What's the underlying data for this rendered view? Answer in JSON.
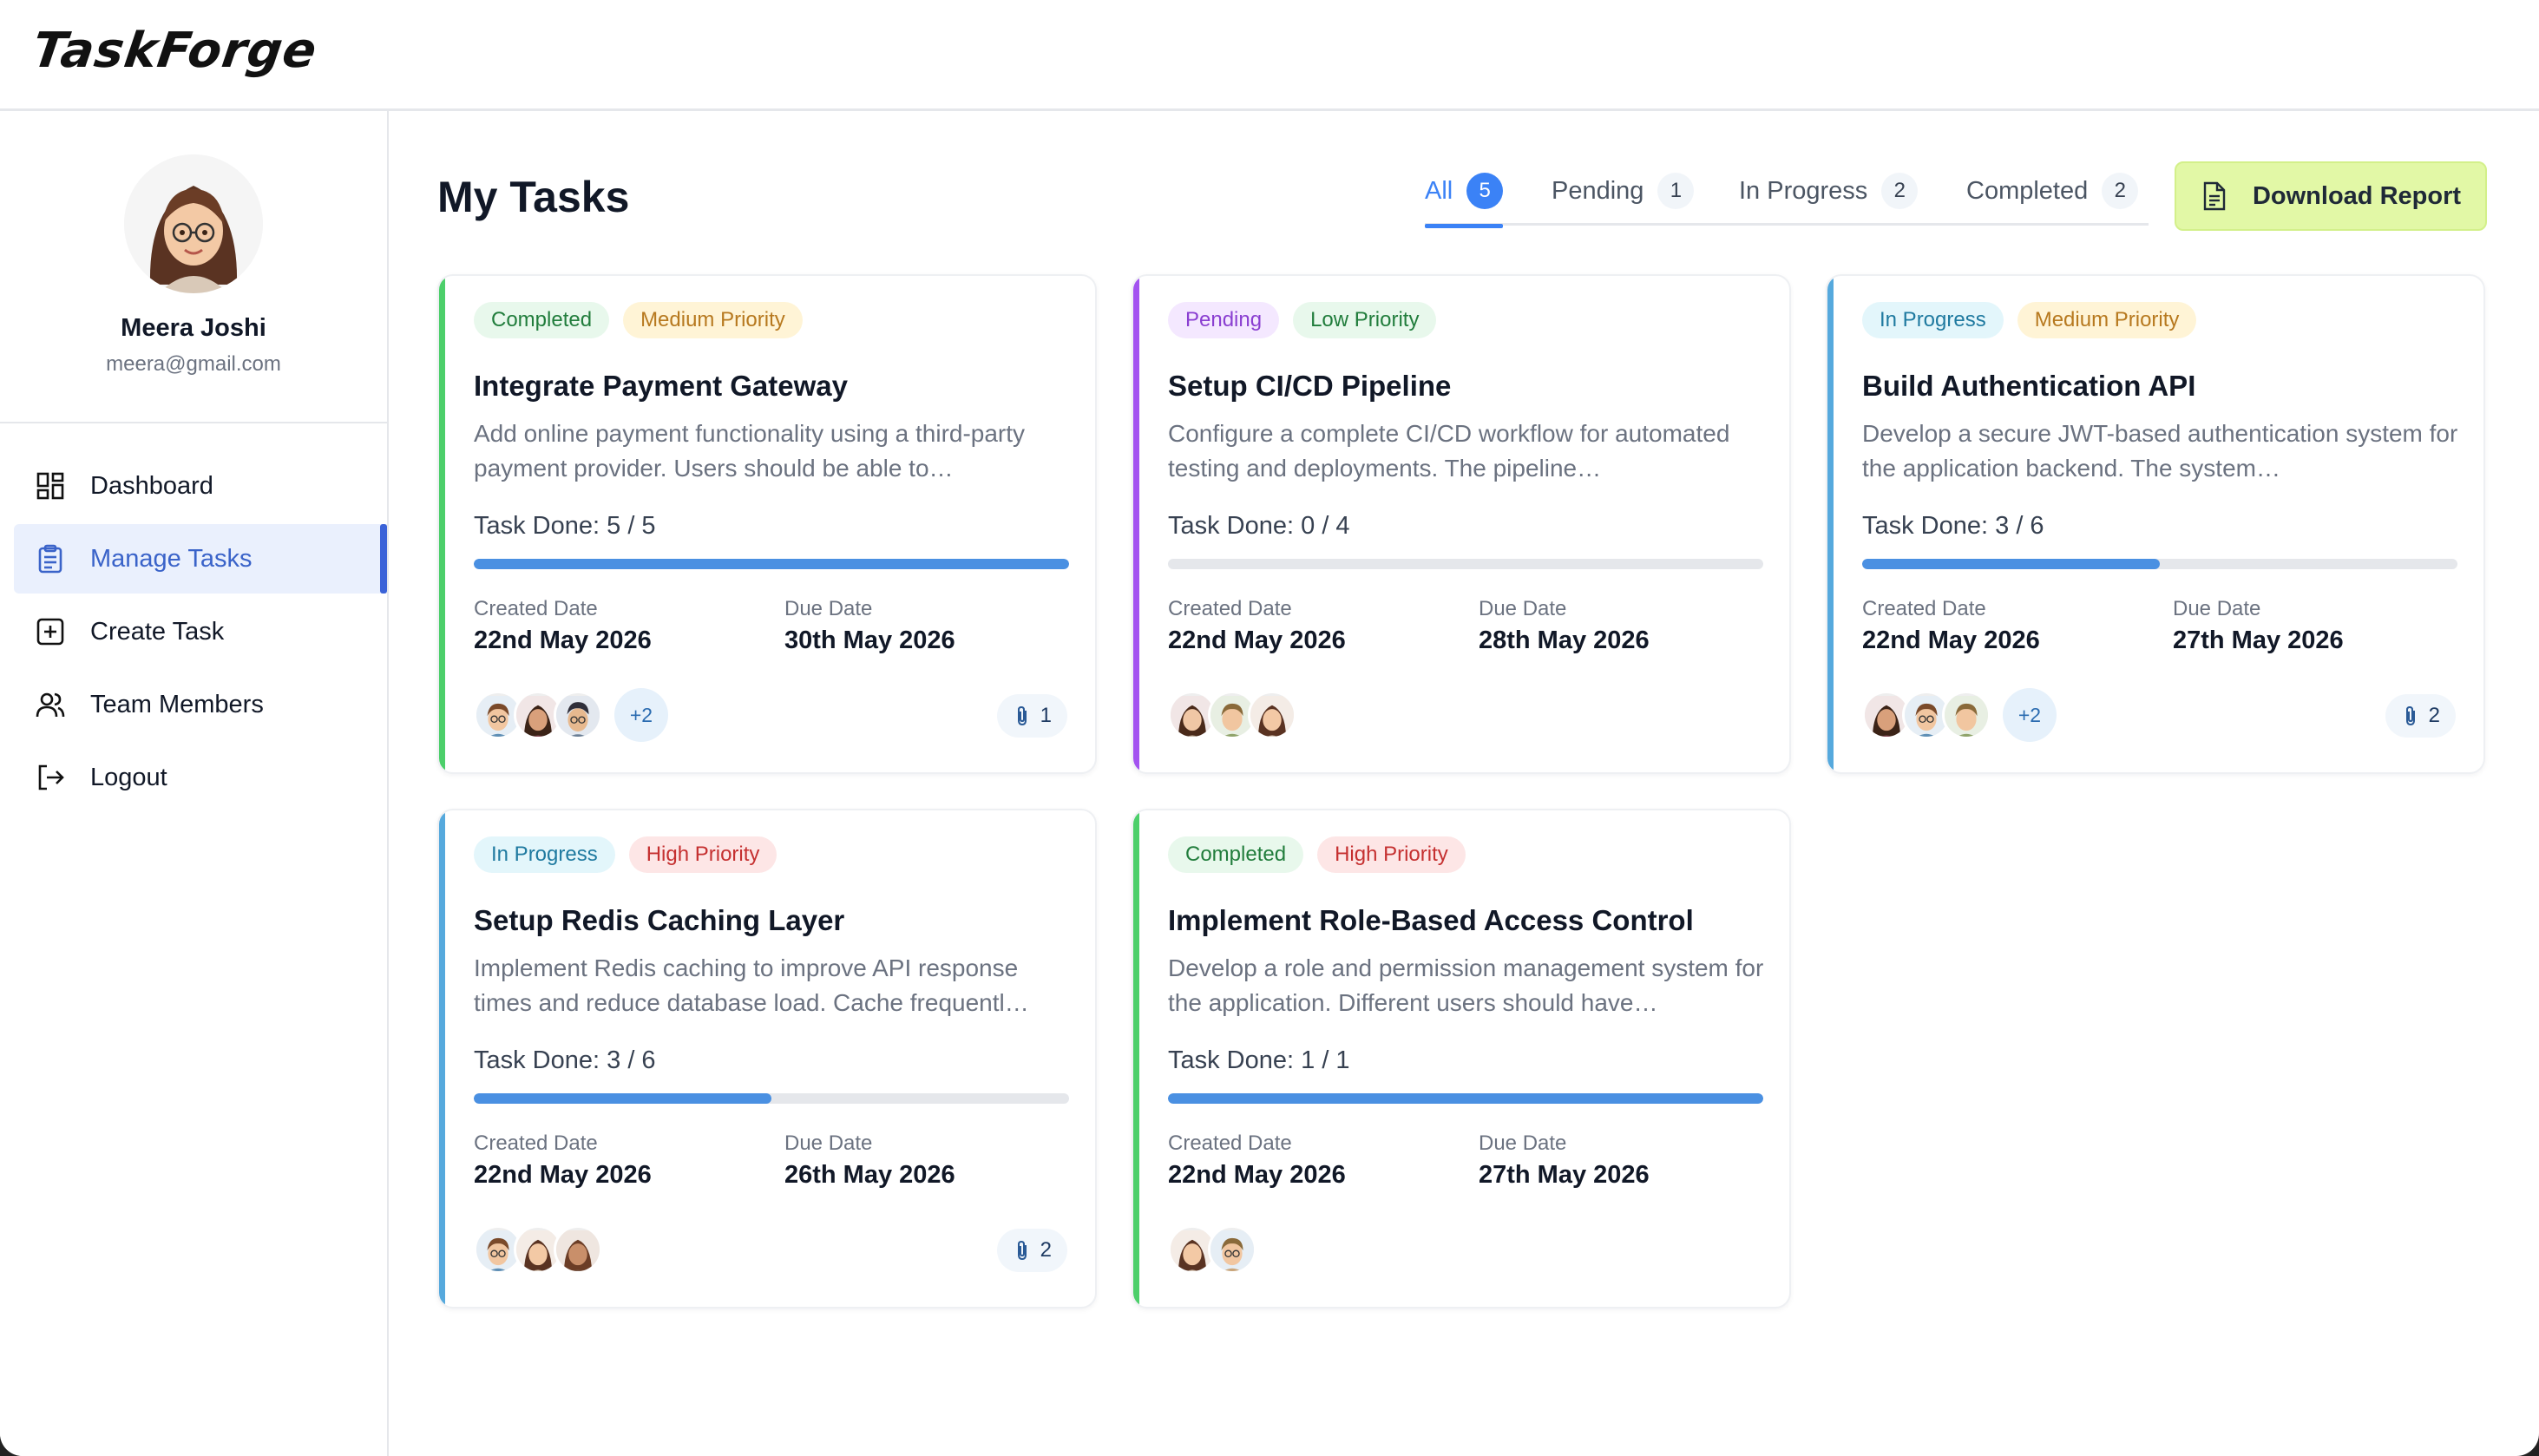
{
  "app": {
    "logo": "TaskForge"
  },
  "user": {
    "name": "Meera Joshi",
    "email": "meera@gmail.com"
  },
  "sidebar": {
    "items": [
      {
        "label": "Dashboard",
        "icon": "dashboard-grid-icon",
        "active": false
      },
      {
        "label": "Manage Tasks",
        "icon": "clipboard-icon",
        "active": true
      },
      {
        "label": "Create Task",
        "icon": "plus-square-icon",
        "active": false
      },
      {
        "label": "Team Members",
        "icon": "users-icon",
        "active": false
      },
      {
        "label": "Logout",
        "icon": "logout-icon",
        "active": false
      }
    ]
  },
  "main": {
    "title": "My Tasks",
    "tabs": [
      {
        "label": "All",
        "count": "5",
        "active": true
      },
      {
        "label": "Pending",
        "count": "1",
        "active": false
      },
      {
        "label": "In Progress",
        "count": "2",
        "active": false
      },
      {
        "label": "Completed",
        "count": "2",
        "active": false
      }
    ],
    "download_label": "Download Report"
  },
  "colors": {
    "accent_blue": "#3b82f6",
    "completed": "#4ccf6a",
    "pending": "#a353f0",
    "in_progress": "#56a9dd",
    "download_bg": "#e2f8a6"
  },
  "labels": {
    "created": "Created Date",
    "due": "Due Date",
    "task_done_prefix": "Task Done:"
  },
  "tasks": [
    {
      "status": "Completed",
      "priority": "Medium Priority",
      "title": "Integrate Payment Gateway",
      "description": "Add online payment functionality using a third-party payment provider. Users should be able to…",
      "progress_text": "Task Done: 5 / 5",
      "progress": 1.0,
      "created": "22nd May 2026",
      "due": "30th May 2026",
      "more": "+2",
      "attachments": "1"
    },
    {
      "status": "Pending",
      "priority": "Low Priority",
      "title": "Setup CI/CD Pipeline",
      "description": "Configure a complete CI/CD workflow for automated testing and deployments. The pipeline…",
      "progress_text": "Task Done: 0 / 4",
      "progress": 0.0,
      "created": "22nd May 2026",
      "due": "28th May 2026",
      "more": "",
      "attachments": ""
    },
    {
      "status": "In Progress",
      "priority": "Medium Priority",
      "title": "Build Authentication API",
      "description": "Develop a secure JWT-based authentication system for the application backend. The system…",
      "progress_text": "Task Done: 3 / 6",
      "progress": 0.5,
      "created": "22nd May 2026",
      "due": "27th May 2026",
      "more": "+2",
      "attachments": "2"
    },
    {
      "status": "In Progress",
      "priority": "High Priority",
      "title": "Setup Redis Caching Layer",
      "description": "Implement Redis caching to improve API response times and reduce database load. Cache frequentl…",
      "progress_text": "Task Done: 3 / 6",
      "progress": 0.5,
      "created": "22nd May 2026",
      "due": "26th May 2026",
      "more": "",
      "attachments": "2"
    },
    {
      "status": "Completed",
      "priority": "High Priority",
      "title": "Implement Role-Based Access Control",
      "description": "Develop a role and permission management system for the application. Different users should have…",
      "progress_text": "Task Done: 1 / 1",
      "progress": 1.0,
      "created": "22nd May 2026",
      "due": "27th May 2026",
      "more": "",
      "attachments": ""
    }
  ]
}
